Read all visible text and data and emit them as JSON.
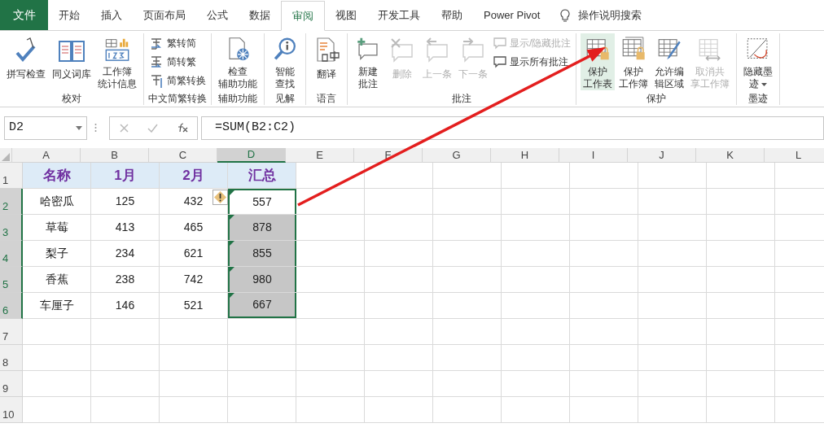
{
  "tabs": [
    {
      "label": "文件",
      "kind": "file",
      "selected": false
    },
    {
      "label": "开始",
      "selected": false
    },
    {
      "label": "插入",
      "selected": false
    },
    {
      "label": "页面布局",
      "selected": false
    },
    {
      "label": "公式",
      "selected": false
    },
    {
      "label": "数据",
      "selected": false
    },
    {
      "label": "审阅",
      "selected": true
    },
    {
      "label": "视图",
      "selected": false
    },
    {
      "label": "开发工具",
      "selected": false
    },
    {
      "label": "帮助",
      "selected": false
    },
    {
      "label": "Power Pivot",
      "selected": false
    }
  ],
  "tell_me": "操作说明搜索",
  "ribbon_groups": [
    {
      "label": "校对",
      "items": [
        {
          "kind": "large",
          "lines": [
            "拼写检查"
          ],
          "disabled": false,
          "selected": false
        },
        {
          "kind": "large",
          "lines": [
            "同义词库"
          ],
          "disabled": false,
          "selected": false
        },
        {
          "kind": "large",
          "lines": [
            "工作簿",
            "统计信息"
          ],
          "disabled": false,
          "selected": false
        }
      ]
    },
    {
      "label": "中文简繁转换",
      "items": [
        {
          "kind": "small",
          "lines": [
            "繁转简"
          ],
          "disabled": false,
          "selected": false
        },
        {
          "kind": "small",
          "lines": [
            "简转繁"
          ],
          "disabled": false,
          "selected": false
        },
        {
          "kind": "small",
          "lines": [
            "简繁转换"
          ],
          "disabled": false,
          "selected": false
        }
      ]
    },
    {
      "label": "辅助功能",
      "items": [
        {
          "kind": "large",
          "lines": [
            "检查",
            "辅助功能"
          ],
          "disabled": false,
          "selected": false
        }
      ]
    },
    {
      "label": "见解",
      "items": [
        {
          "kind": "large",
          "lines": [
            "智能",
            "查找"
          ],
          "disabled": false,
          "selected": false
        }
      ]
    },
    {
      "label": "语言",
      "items": [
        {
          "kind": "large",
          "lines": [
            "翻译"
          ],
          "disabled": false,
          "selected": false
        }
      ]
    },
    {
      "label": "批注",
      "items": [
        {
          "kind": "large",
          "lines": [
            "新建",
            "批注"
          ],
          "disabled": false,
          "selected": false
        },
        {
          "kind": "large",
          "lines": [
            "删除"
          ],
          "disabled": true,
          "selected": false
        },
        {
          "kind": "large",
          "lines": [
            "上一条"
          ],
          "disabled": true,
          "selected": false
        },
        {
          "kind": "large",
          "lines": [
            "下一条"
          ],
          "disabled": true,
          "selected": false
        },
        {
          "kind": "small",
          "lines": [
            "显示/隐藏批注"
          ],
          "disabled": true,
          "selected": false
        },
        {
          "kind": "small",
          "lines": [
            "显示所有批注"
          ],
          "disabled": false,
          "selected": false
        }
      ]
    },
    {
      "label": "保护",
      "items": [
        {
          "kind": "large",
          "lines": [
            "保护",
            "工作表"
          ],
          "disabled": false,
          "selected": true
        },
        {
          "kind": "large",
          "lines": [
            "保护",
            "工作簿"
          ],
          "disabled": false,
          "selected": false
        },
        {
          "kind": "large",
          "lines": [
            "允许编",
            "辑区域"
          ],
          "disabled": false,
          "selected": false
        },
        {
          "kind": "large",
          "lines": [
            "取消共",
            "享工作簿"
          ],
          "disabled": true,
          "selected": false
        }
      ]
    },
    {
      "label": "墨迹",
      "items": [
        {
          "kind": "dropdown",
          "lines": [
            "隐藏墨",
            "迹"
          ],
          "disabled": false,
          "selected": false
        }
      ]
    }
  ],
  "formula_bar": {
    "name_box": "D2",
    "formula": "=SUM(B2:C2)"
  },
  "sheet": {
    "columns": [
      {
        "label": "A",
        "selected": false
      },
      {
        "label": "B",
        "selected": false
      },
      {
        "label": "C",
        "selected": false
      },
      {
        "label": "D",
        "selected": true
      },
      {
        "label": "E",
        "selected": false
      },
      {
        "label": "F",
        "selected": false
      },
      {
        "label": "G",
        "selected": false
      },
      {
        "label": "H",
        "selected": false
      },
      {
        "label": "I",
        "selected": false
      },
      {
        "label": "J",
        "selected": false
      },
      {
        "label": "K",
        "selected": false
      },
      {
        "label": "L",
        "selected": false
      }
    ],
    "rows": [
      {
        "number": "1",
        "kind": "header",
        "selected": false,
        "cells": [
          {
            "text": "名称"
          },
          {
            "text": "1月"
          },
          {
            "text": "2月"
          },
          {
            "text": "汇总"
          }
        ]
      },
      {
        "number": "2",
        "selected": true,
        "cells": [
          {
            "text": "哈密瓜"
          },
          {
            "text": "125"
          },
          {
            "text": "432",
            "warning": true
          },
          {
            "text": "557",
            "flagged": true,
            "highlighted": false
          }
        ]
      },
      {
        "number": "3",
        "selected": true,
        "cells": [
          {
            "text": "草莓"
          },
          {
            "text": "413"
          },
          {
            "text": "465"
          },
          {
            "text": "878",
            "flagged": true,
            "highlighted": true
          }
        ]
      },
      {
        "number": "4",
        "selected": true,
        "cells": [
          {
            "text": "梨子"
          },
          {
            "text": "234"
          },
          {
            "text": "621"
          },
          {
            "text": "855",
            "flagged": true,
            "highlighted": true
          }
        ]
      },
      {
        "number": "5",
        "selected": true,
        "cells": [
          {
            "text": "香蕉"
          },
          {
            "text": "238"
          },
          {
            "text": "742"
          },
          {
            "text": "980",
            "flagged": true,
            "highlighted": true
          }
        ]
      },
      {
        "number": "6",
        "selected": true,
        "cells": [
          {
            "text": "车厘子"
          },
          {
            "text": "146"
          },
          {
            "text": "521"
          },
          {
            "text": "667",
            "flagged": true,
            "highlighted": true
          }
        ]
      },
      {
        "number": "7",
        "selected": false,
        "cells": []
      },
      {
        "number": "8",
        "selected": false,
        "cells": []
      },
      {
        "number": "9",
        "selected": false,
        "cells": []
      },
      {
        "number": "10",
        "selected": false,
        "cells": []
      }
    ]
  }
}
